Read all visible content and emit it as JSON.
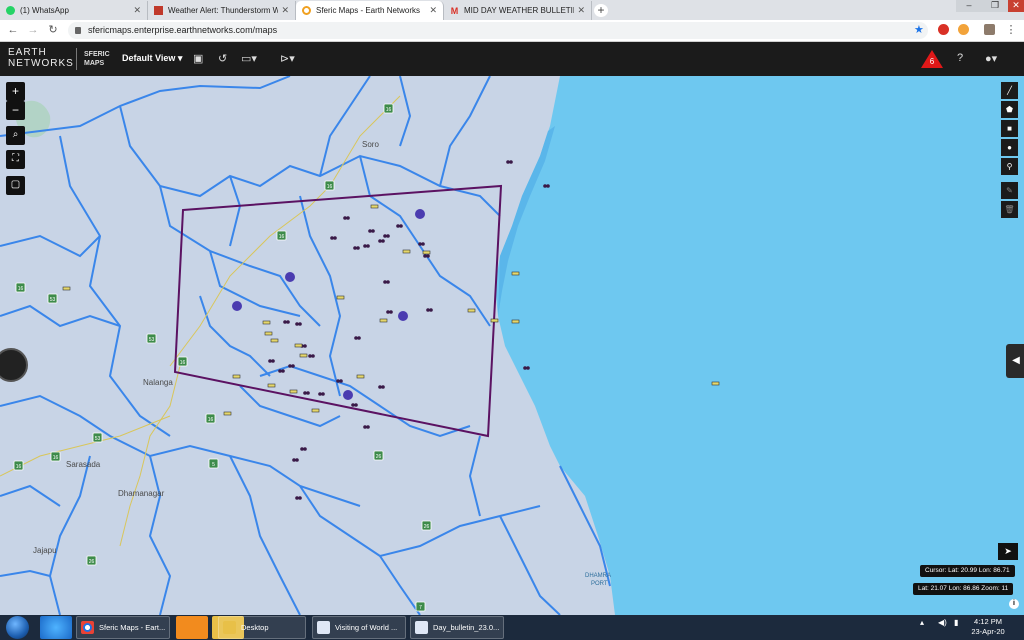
{
  "browser": {
    "tabs": [
      {
        "title": "(1) WhatsApp",
        "color": "#25d366"
      },
      {
        "title": "Weather Alert: Thunderstorm Wi",
        "color": "#c0392b"
      },
      {
        "title": "Sferic Maps - Earth Networks",
        "color": "#f0a020"
      },
      {
        "title": "MID DAY WEATHER BULLETIN Da",
        "color": "#d93025"
      }
    ],
    "new_tab_label": "+",
    "url": "sfericmaps.enterprise.earthnetworks.com/maps"
  },
  "app": {
    "logo_line1": "EARTH",
    "logo_line2": "NETWORKS",
    "product_line1": "SFERIC",
    "product_line2": "MAPS",
    "view_label": "Default View",
    "alert_count": "6"
  },
  "map": {
    "places": [
      {
        "name": "Soro"
      },
      {
        "name": "Nalanga"
      },
      {
        "name": "Sarasada"
      },
      {
        "name": "Dhamanagar"
      },
      {
        "name": "Jajapu"
      },
      {
        "name": "DHAMRA"
      },
      {
        "name": "PORT"
      }
    ],
    "shields": [
      "16",
      "16",
      "16",
      "16",
      "16",
      "53",
      "53",
      "53",
      "16",
      "16",
      "16",
      "5",
      "26",
      "26",
      "26",
      "7",
      "7",
      "7",
      "20",
      "7"
    ],
    "cursor_readout": "Cursor: Lat: 20.99 Lon: 86.71",
    "view_readout": "Lat: 21.07 Lon: 86.86 Zoom: 11",
    "zoom_in": "+",
    "zoom_out": "−"
  },
  "taskbar": {
    "windows": [
      {
        "label": "Sferic Maps - Eart..."
      },
      {
        "label": "Desktop"
      },
      {
        "label": "Visiting of World ..."
      },
      {
        "label": "Day_bulletin_23.0..."
      }
    ],
    "time": "4:12 PM",
    "date": "23-Apr-20"
  },
  "colors": {
    "sea": "#6ec8f0",
    "land": "#c8d4e6",
    "district_line": "#2e7be6",
    "polygon": "#5b1262",
    "lightning": "#3a1a48"
  }
}
